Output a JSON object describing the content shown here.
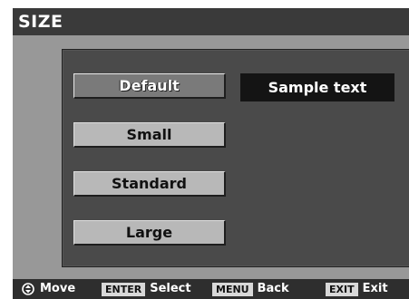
{
  "header": {
    "title": "SIZE"
  },
  "options": [
    {
      "label": "Default",
      "selected": true
    },
    {
      "label": "Small",
      "selected": false
    },
    {
      "label": "Standard",
      "selected": false
    },
    {
      "label": "Large",
      "selected": false
    }
  ],
  "preview": {
    "text": "Sample text"
  },
  "footer": {
    "move": {
      "icon": "updown-circle-icon",
      "label": "Move"
    },
    "select": {
      "key": "ENTER",
      "label": "Select"
    },
    "back": {
      "key": "MENU",
      "label": "Back"
    },
    "exit": {
      "key": "EXIT",
      "label": "Exit"
    }
  },
  "colors": {
    "selected_bg": "#7a7a7a",
    "option_bg": "#b8b8b8",
    "panel_bg": "#4a4a4a",
    "preview_bg": "#141414"
  }
}
